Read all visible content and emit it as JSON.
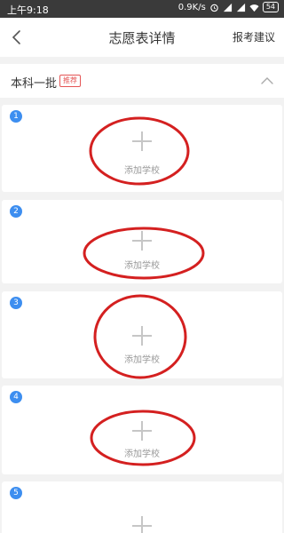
{
  "statusbar": {
    "time": "上午9:18",
    "speed": "0.9K/s",
    "battery": "54"
  },
  "navbar": {
    "title": "志愿表详情",
    "action": "报考建议"
  },
  "section": {
    "title": "本科一批",
    "badge": "推荐"
  },
  "slots": [
    {
      "number": "1",
      "label": "添加学校"
    },
    {
      "number": "2",
      "label": "添加学校"
    },
    {
      "number": "3",
      "label": "添加学校"
    },
    {
      "number": "4",
      "label": "添加学校"
    },
    {
      "number": "5",
      "label": ""
    }
  ],
  "colors": {
    "accent": "#3d8ef0",
    "badge": "#e45555",
    "annotation": "#d42020"
  }
}
